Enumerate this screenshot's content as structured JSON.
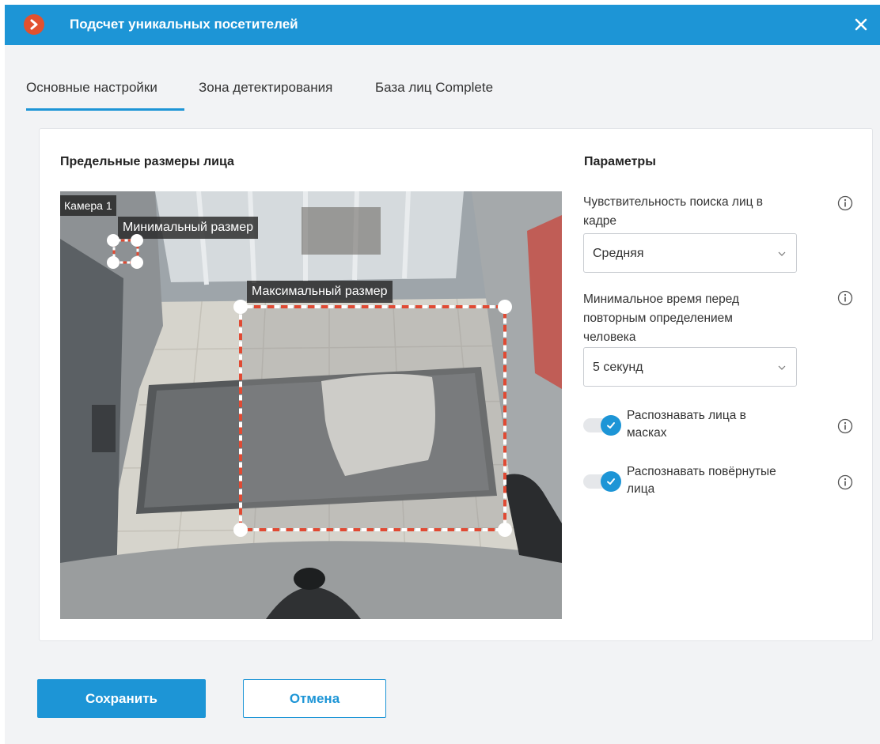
{
  "window": {
    "title": "Подсчет уникальных посетителей"
  },
  "tabs": [
    {
      "label": "Основные настройки",
      "active": true
    },
    {
      "label": "Зона детектирования",
      "active": false
    },
    {
      "label": "База лиц Complete",
      "active": false
    }
  ],
  "face_sizes": {
    "title": "Предельные размеры лица",
    "camera_label": "Камера 1",
    "min_label": "Минимальный размер",
    "max_label": "Максимальный размер"
  },
  "params": {
    "title": "Параметры",
    "sensitivity": {
      "label_line1": "Чувствительность поиска лиц в",
      "label_line2": "кадре",
      "value": "Средняя"
    },
    "min_time": {
      "label_line1": "Минимальное время перед",
      "label_line2": "повторным определением",
      "label_line3": "человека",
      "value": "5 секунд"
    },
    "mask_toggle": {
      "label_line1": "Распознавать лица в",
      "label_line2": "масках",
      "checked": true
    },
    "rotated_toggle": {
      "label_line1": "Распознавать повёрнутые",
      "label_line2": "лица",
      "checked": true
    }
  },
  "footer": {
    "save_label": "Сохранить",
    "cancel_label": "Отмена"
  },
  "colors": {
    "accent": "#1d95d6",
    "logo": "#e2512f",
    "dashed_box": "#e04a33"
  }
}
